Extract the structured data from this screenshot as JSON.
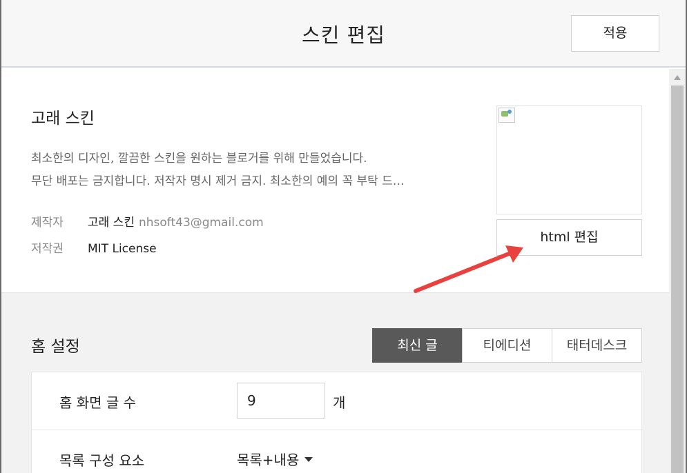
{
  "header": {
    "title": "스킨 편집",
    "apply_label": "적용"
  },
  "skin": {
    "name": "고래 스킨",
    "description_line1": "최소한의 디자인, 깔끔한 스킨을 원하는 블로거를 위해 만들었습니다.",
    "description_line2": "무단 배포는 금지합니다. 저작자 명시 제거 금지. 최소한의 예의 꼭 부탁 드…",
    "author_label": "제작자",
    "author_name": "고래 스킨",
    "author_email": "nhsoft43@gmail.com",
    "license_label": "저작권",
    "license_value": "MIT License",
    "html_edit_label": "html 편집"
  },
  "home": {
    "title": "홈 설정",
    "tabs": [
      {
        "label": "최신 글",
        "active": true
      },
      {
        "label": "티에디션",
        "active": false
      },
      {
        "label": "태터데스크",
        "active": false
      }
    ],
    "post_count_label": "홈 화면 글 수",
    "post_count_value": "9",
    "post_count_unit": "개",
    "list_component_label": "목록 구성 요소",
    "list_component_value": "목록+내용"
  },
  "colors": {
    "annotation_arrow": "#e8413e",
    "active_tab": "#595959"
  }
}
